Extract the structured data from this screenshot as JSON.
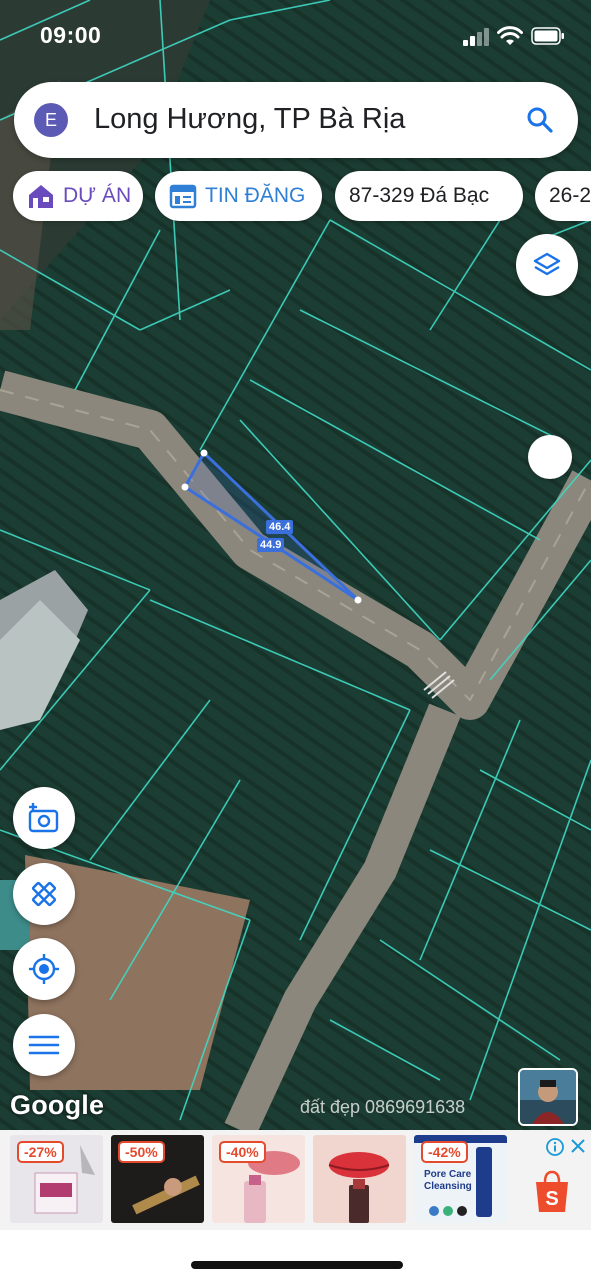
{
  "status_bar": {
    "time": "09:00"
  },
  "search": {
    "avatar_letter": "E",
    "query": "Long Hương, TP Bà Rịa"
  },
  "chips": [
    {
      "label": "DỰ ÁN",
      "icon": "house-icon"
    },
    {
      "label": "TIN ĐĂNG",
      "icon": "listing-icon"
    },
    {
      "label": "87-329 Đá Bạc"
    },
    {
      "label": "26-2"
    }
  ],
  "map": {
    "measure_labels": [
      "46.4",
      "44.9"
    ],
    "google_logo": "Google",
    "watermark": "đất đẹp 0869691638"
  },
  "ads": {
    "discounts": [
      "-27%",
      "-50%",
      "-40%",
      "",
      "-42%"
    ],
    "product_text": "Pore Care Cleansing",
    "brand_icon": "shopee-bag-icon"
  },
  "colors": {
    "brand_purple": "#6a4bbd",
    "brand_blue": "#2f7fd6",
    "parcel_lines": "#3fd9c4",
    "selected_parcel": "#3b6fdc",
    "discount_red": "#e54a2d",
    "shopee_orange": "#ee4d2d"
  }
}
